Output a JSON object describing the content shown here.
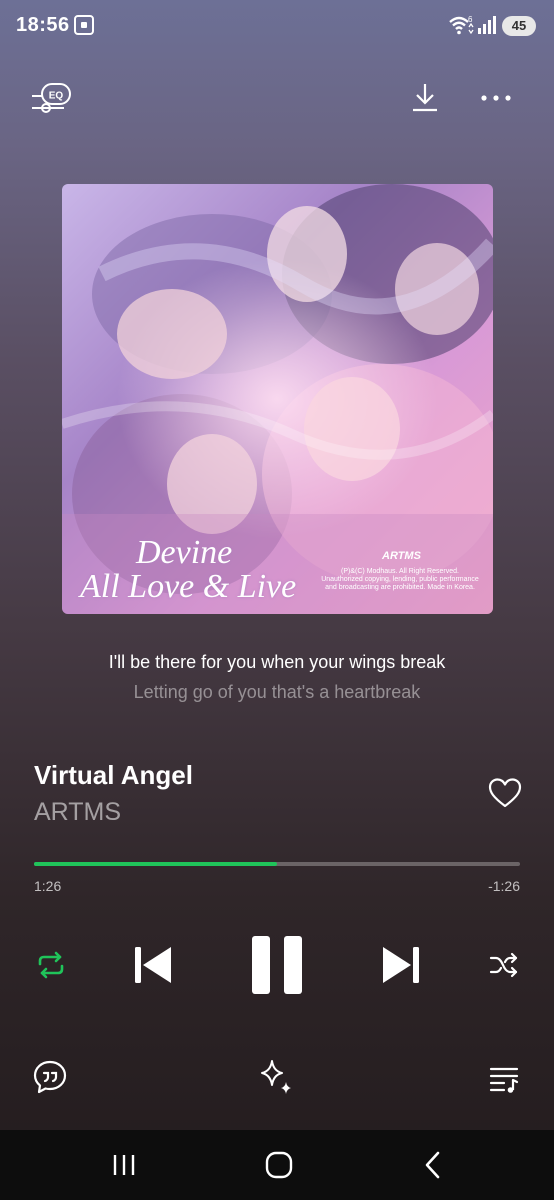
{
  "status_bar": {
    "time": "18:56",
    "battery": "45",
    "wifi_label": "6"
  },
  "top_bar": {
    "eq_label": "EQ"
  },
  "album": {
    "title_line1": "Devine",
    "title_line2": "All Love & Live",
    "brand": "ARTMS",
    "copyright": "(P)&(C) Modhaus. All Right Reserved. Unauthorized copying, lending, public performance and broadcasting are prohibited. Made in Korea."
  },
  "lyrics": {
    "current": "I'll be there for you when your wings break",
    "next": "Letting go of you that's a heartbreak"
  },
  "track": {
    "title": "Virtual Angel",
    "artist": "ARTMS"
  },
  "playback": {
    "elapsed": "1:26",
    "remaining": "-1:26",
    "progress": 0.5,
    "repeat_active": true,
    "state": "playing"
  },
  "colors": {
    "accent": "#20c45a",
    "nav_bar": "#0d0d0d"
  },
  "icons": {
    "eq": "eq-icon",
    "download": "download-icon",
    "more": "more-icon",
    "like": "heart-icon",
    "repeat": "repeat-icon",
    "previous": "skip-previous-icon",
    "pause": "pause-icon",
    "next": "skip-next-icon",
    "shuffle": "shuffle-icon",
    "lyrics": "lyrics-icon",
    "sparkle": "sparkle-icon",
    "queue": "queue-icon"
  }
}
